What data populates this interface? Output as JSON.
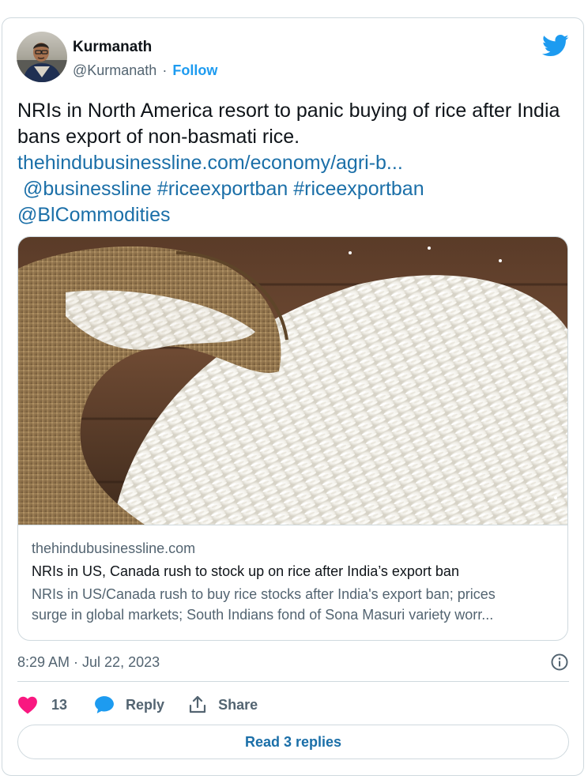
{
  "author": {
    "name": "Kurmanath",
    "handle": "@Kurmanath",
    "separator": "·",
    "follow_label": "Follow"
  },
  "tweet": {
    "text_line1": "NRIs in North America resort to panic buying of rice after India bans export of non-basmati rice.",
    "link": "thehindubusinessline.com/economy/agri-b...",
    "mention1": "@businessline",
    "hashtag1": "#riceexportban",
    "hashtag2": "#riceexportban",
    "mention2": "@BlCommodities"
  },
  "card": {
    "image_icon": "rice-in-burlap-sack-photo",
    "domain": "thehindubusinessline.com",
    "title": "NRIs in US, Canada rush to stock up on rice after India’s export ban",
    "description": "NRIs in US/Canada rush to buy rice stocks after India's export ban; prices\nsurge in global markets; South Indians fond of Sona Masuri variety worr..."
  },
  "meta": {
    "timestamp": "8:29 AM · Jul 22, 2023"
  },
  "actions": {
    "like_count": "13",
    "reply_label": "Reply",
    "share_label": "Share",
    "read_replies_label": "Read 3 replies"
  },
  "colors": {
    "accent": "#1d9bf0",
    "like": "#f91880",
    "link": "#1b6fa8",
    "muted": "#536471",
    "border": "#cfd9de"
  }
}
